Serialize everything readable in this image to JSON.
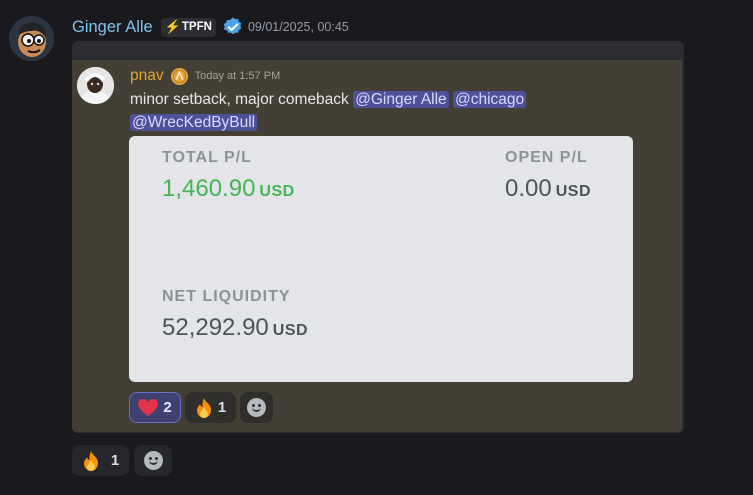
{
  "message": {
    "author": "Ginger Alle",
    "tag": "TPFN",
    "timestamp": "09/01/2025, 00:45"
  },
  "forwarded": {
    "author": "pnav",
    "timestamp": "Today at 1:57 PM",
    "text": "minor setback, major comeback",
    "mentions": [
      "@Ginger Alle",
      "@chicago",
      "@WrecKedByBull"
    ]
  },
  "card": {
    "total_pl_label": "TOTAL P/L",
    "total_pl_value": "1,460.90",
    "open_pl_label": "OPEN P/L",
    "open_pl_value": "0.00",
    "net_liquidity_label": "NET LIQUIDITY",
    "net_liquidity_value": "52,292.90",
    "currency": "USD"
  },
  "reactions_inner": [
    {
      "emoji": "heart",
      "count": "2",
      "active": true
    },
    {
      "emoji": "fire",
      "count": "1",
      "active": false
    }
  ],
  "reactions_outer": [
    {
      "emoji": "fire",
      "count": "1",
      "active": false
    }
  ],
  "colors": {
    "author_name": "#7cc3e8",
    "inner_author": "#e0a832",
    "mention_bg": "#4e5199",
    "gain_green": "#43b553"
  }
}
